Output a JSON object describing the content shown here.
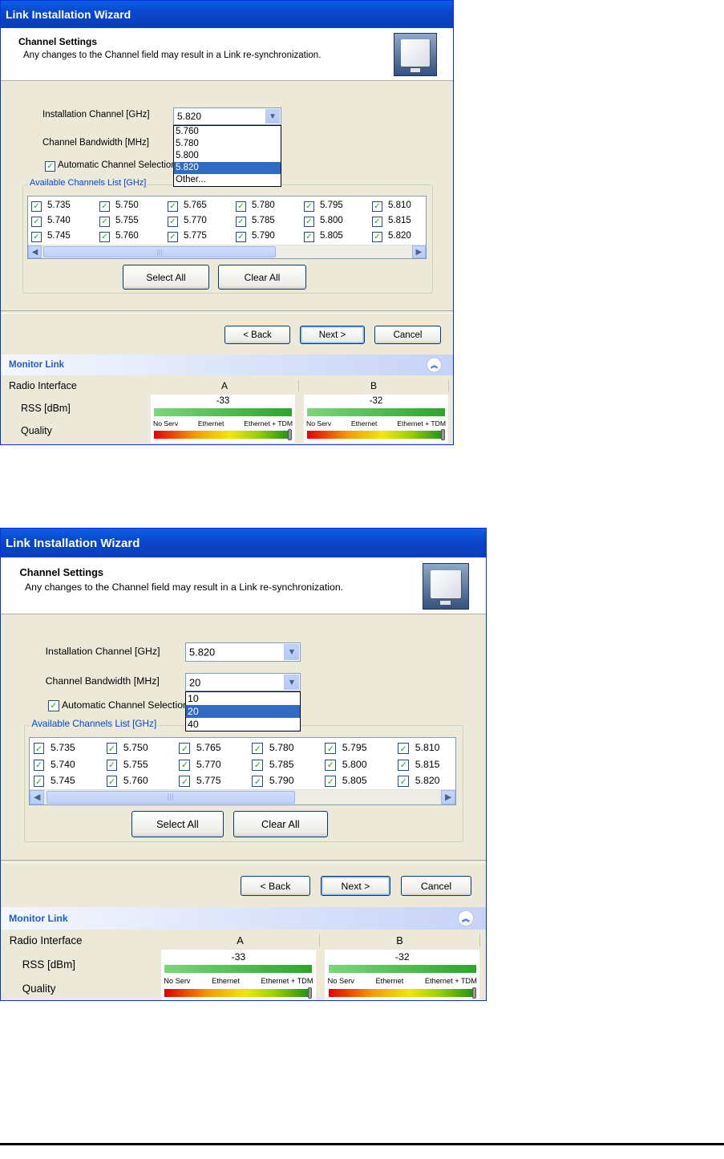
{
  "screens": [
    {
      "window_title": "Link Installation Wizard",
      "header_title": "Channel Settings",
      "header_subtitle": "Any changes to the Channel field may result in a Link re-synchronization.",
      "installation_channel_label": "Installation Channel [GHz]",
      "installation_channel_value": "5.820",
      "channel_bandwidth_label": "Channel Bandwidth [MHz]",
      "auto_channel_label": "Automatic Channel Selection",
      "open_dropdown_options": [
        "5.760",
        "5.780",
        "5.800",
        "5.820",
        "Other..."
      ],
      "open_dropdown_selected": "5.820",
      "channels_group_label": "Available Channels List [GHz]",
      "select_all_label": "Select All",
      "clear_all_label": "Clear All",
      "back_label": "< Back",
      "next_label": "Next >",
      "cancel_label": "Cancel",
      "monitor_link_label": "Monitor Link",
      "radio_interface_label": "Radio Interface",
      "col_a": "A",
      "col_b": "B",
      "rss_label": "RSS [dBm]",
      "quality_label": "Quality",
      "rss_a": "-33",
      "rss_b": "-32",
      "quality_scale": [
        "No Serv",
        "Ethernet",
        "Ethernet + TDM"
      ]
    },
    {
      "window_title": "Link Installation Wizard",
      "header_title": "Channel Settings",
      "header_subtitle": "Any changes to the Channel field may result in a Link re-synchronization.",
      "installation_channel_label": "Installation Channel [GHz]",
      "installation_channel_value": "5.820",
      "channel_bandwidth_label": "Channel Bandwidth [MHz]",
      "channel_bandwidth_value": "20",
      "auto_channel_label": "Automatic Channel Selection",
      "open_dropdown_options": [
        "10",
        "20",
        "40"
      ],
      "open_dropdown_selected": "20",
      "channels_group_label": "Available Channels List [GHz]",
      "select_all_label": "Select All",
      "clear_all_label": "Clear All",
      "back_label": "< Back",
      "next_label": "Next >",
      "cancel_label": "Cancel",
      "monitor_link_label": "Monitor Link",
      "radio_interface_label": "Radio Interface",
      "col_a": "A",
      "col_b": "B",
      "rss_label": "RSS [dBm]",
      "quality_label": "Quality",
      "rss_a": "-33",
      "rss_b": "-32",
      "quality_scale": [
        "No Serv",
        "Ethernet",
        "Ethernet + TDM"
      ]
    }
  ],
  "channels": [
    [
      "5.735",
      "5.750",
      "5.765",
      "5.780",
      "5.795",
      "5.810"
    ],
    [
      "5.740",
      "5.755",
      "5.770",
      "5.785",
      "5.800",
      "5.815"
    ],
    [
      "5.745",
      "5.760",
      "5.775",
      "5.790",
      "5.805",
      "5.820"
    ]
  ],
  "channels_checked": true,
  "icons": {
    "check": "✓",
    "combo_arrow": "chevron-down-icon",
    "scroll_left": "arrow-left-icon",
    "scroll_right": "arrow-right-icon",
    "collapse": "double-chevron-up-icon"
  }
}
